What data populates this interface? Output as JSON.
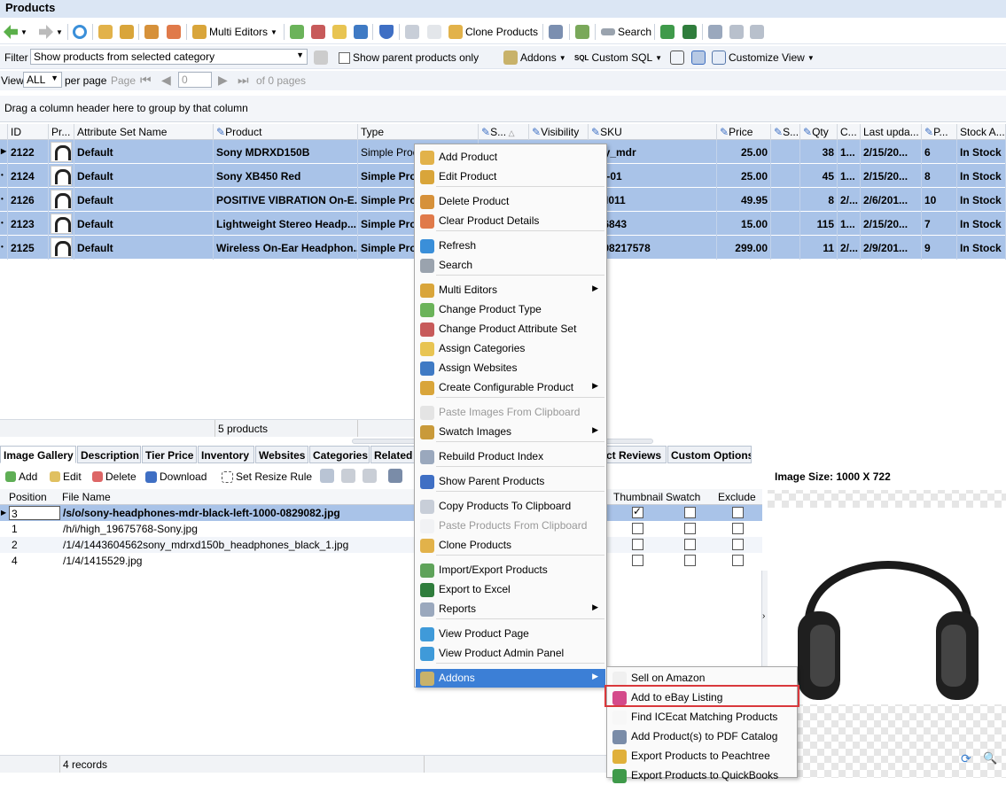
{
  "window": {
    "title": "Products"
  },
  "toolbar": {
    "multi_editors": "Multi Editors",
    "clone_products": "Clone Products",
    "search": "Search"
  },
  "filterbar": {
    "filter_label": "Filter",
    "filter_value": "Show products from selected category",
    "show_parent": "Show parent products only",
    "addons": "Addons",
    "custom_sql": "Custom SQL",
    "customize_view": "Customize View"
  },
  "viewbar": {
    "view_label": "View",
    "per_page_value": "ALL",
    "per_page_label": "per page",
    "page_label": "Page",
    "page_value": "0",
    "of_pages": "of 0 pages"
  },
  "groupbar": {
    "hint": "Drag a column header here to group by that column"
  },
  "grid": {
    "columns": [
      "ID",
      "Pr...",
      "Attribute Set Name",
      "Product",
      "Type",
      "S...",
      "Visibility",
      "SKU",
      "Price",
      "S...",
      "Qty",
      "C...",
      "Last upda...",
      "P...",
      "Stock A..."
    ],
    "rows": [
      {
        "id": "2122",
        "attr": "Default",
        "product": "Sony MDRXD150B",
        "type": "Simple Produ",
        "sku": "ony_mdr",
        "price": "25.00",
        "qty": "38",
        "c": "1...",
        "updated": "2/15/20...",
        "p": "6",
        "stock": "In Stock"
      },
      {
        "id": "2124",
        "attr": "Default",
        "product": "Sony XB450 Red",
        "type": "Simple Pro",
        "sku": "HD-01",
        "price": "25.00",
        "qty": "45",
        "c": "1...",
        "updated": "2/15/20...",
        "p": "8",
        "stock": "In Stock"
      },
      {
        "id": "2126",
        "attr": "Default",
        "product": "POSITIVE VIBRATION On-E...",
        "type": "Simple Pro",
        "sku": "-JH011",
        "price": "49.95",
        "qty": "8",
        "c": "2/...",
        "updated": "2/6/201...",
        "p": "10",
        "stock": "In Stock"
      },
      {
        "id": "2123",
        "attr": "Default",
        "product": "Lightweight Stereo Headp...",
        "type": "Simple Pro",
        "sku": "456843",
        "price": "15.00",
        "qty": "115",
        "c": "1...",
        "updated": "2/15/20...",
        "p": "7",
        "stock": "In Stock"
      },
      {
        "id": "2125",
        "attr": "Default",
        "product": "Wireless On-Ear Headphon...",
        "type": "Simple Pro",
        "sku": "0198217578",
        "price": "299.00",
        "qty": "11",
        "c": "2/...",
        "updated": "2/9/201...",
        "p": "9",
        "stock": "In Stock"
      }
    ],
    "status": "5 products"
  },
  "tabs": [
    "Image Gallery",
    "Description",
    "Tier Price",
    "Inventory",
    "Websites",
    "Categories",
    "Related",
    "ct Reviews",
    "Custom Options"
  ],
  "gallery": {
    "add": "Add",
    "edit": "Edit",
    "delete": "Delete",
    "download": "Download",
    "set_resize": "Set Resize Rule",
    "columns": [
      "Position",
      "File Name",
      "Thumbnail",
      "Swatch",
      "Exclude"
    ],
    "rows": [
      {
        "position": "3",
        "file": "/s/o/sony-headphones-mdr-black-left-1000-0829082.jpg"
      },
      {
        "position": "1",
        "file": "/h/i/high_19675768-Sony.jpg"
      },
      {
        "position": "2",
        "file": "/1/4/1443604562sony_mdrxd150b_headphones_black_1.jpg"
      },
      {
        "position": "4",
        "file": "/1/4/1415529.jpg"
      }
    ],
    "status": "4 records"
  },
  "preview": {
    "size_label": "Image Size: 1000 X 722"
  },
  "context_menu": {
    "items": [
      "Add Product",
      "Edit Product",
      "Delete Product",
      "Clear Product Details",
      "Refresh",
      "Search",
      "Multi Editors",
      "Change Product Type",
      "Change Product Attribute Set",
      "Assign Categories",
      "Assign Websites",
      "Create Configurable Product",
      "Paste Images From Clipboard",
      "Swatch Images",
      "Rebuild Product Index",
      "Show Parent Products",
      "Copy Products To Clipboard",
      "Paste Products From Clipboard",
      "Clone Products",
      "Import/Export Products",
      "Export to Excel",
      "Reports",
      "View Product Page",
      "View Product Admin Panel",
      "Addons"
    ]
  },
  "addons_submenu": {
    "items": [
      "Sell on Amazon",
      "Add to eBay Listing",
      "Find ICEcat Matching Products",
      "Add Product(s) to PDF Catalog",
      "Export Products to Peachtree",
      "Export Products to QuickBooks"
    ]
  },
  "colors": {
    "selection": "#a9c3e8",
    "highlight": "#3c7fd6",
    "callout": "#d9383c"
  }
}
